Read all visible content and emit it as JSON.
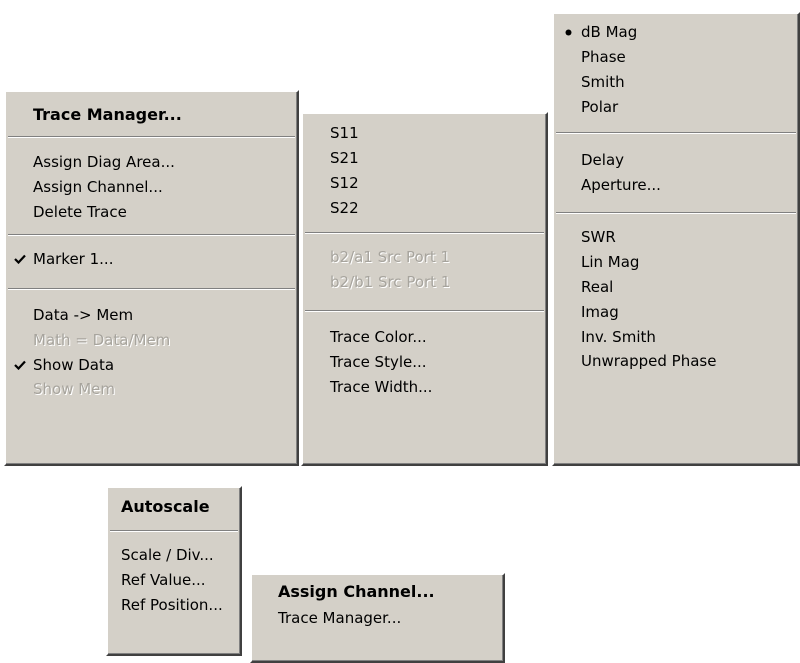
{
  "trace_menu": {
    "header": "Trace Manager...",
    "items": [
      "Assign Diag Area...",
      "Assign Channel...",
      "Delete Trace",
      "Marker 1...",
      "Data -> Mem",
      "Math = Data/Mem",
      "Show Data",
      "Show Mem"
    ]
  },
  "measure_menu": {
    "items": [
      "S11",
      "S21",
      "S12",
      "S22",
      "b2/a1 Src Port 1",
      "b2/b1 Src Port 1",
      "Trace Color...",
      "Trace Style...",
      "Trace Width..."
    ]
  },
  "format_menu": {
    "items": [
      "dB Mag",
      "Phase",
      "Smith",
      "Polar",
      "Delay",
      "Aperture...",
      "SWR",
      "Lin Mag",
      "Real",
      "Imag",
      "Inv. Smith",
      "Unwrapped Phase"
    ]
  },
  "scale_menu": {
    "header": "Autoscale",
    "items": [
      "Scale / Div...",
      "Ref Value...",
      "Ref Position..."
    ]
  },
  "channel_menu": {
    "header": "Assign Channel...",
    "items": [
      "Trace Manager..."
    ]
  }
}
